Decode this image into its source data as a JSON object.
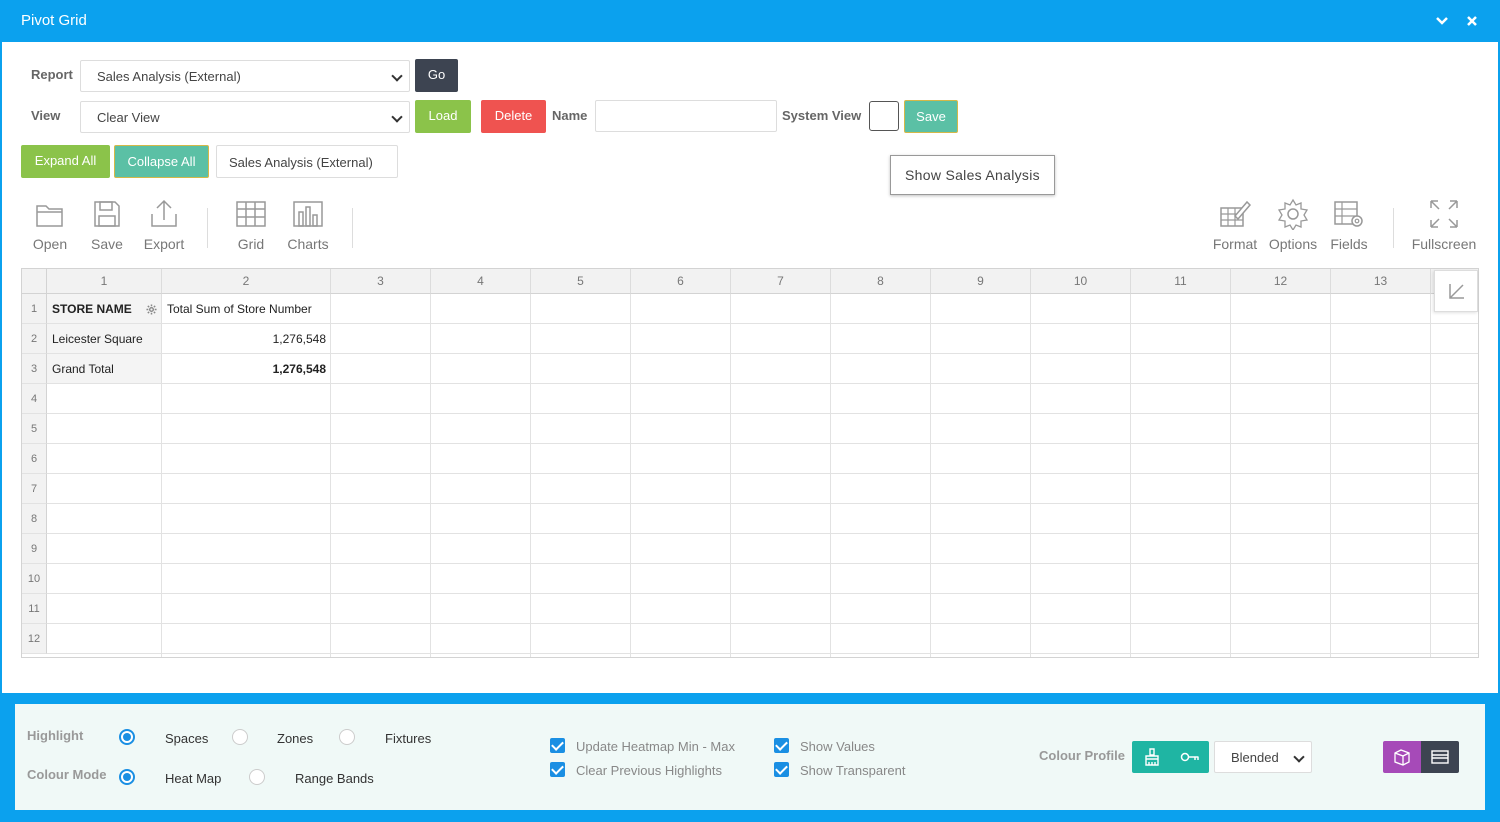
{
  "window": {
    "title": "Pivot Grid"
  },
  "controls": {
    "report_label": "Report",
    "report_value": "Sales Analysis (External)",
    "go_label": "Go",
    "view_label": "View",
    "view_value": "Clear View",
    "load_label": "Load",
    "delete_label": "Delete",
    "name_label": "Name",
    "name_value": "",
    "system_view_label": "System View",
    "save_label": "Save",
    "expand_all_label": "Expand All",
    "collapse_all_label": "Collapse All",
    "report_tag": "Sales Analysis (External)",
    "tooltip": "Show Sales Analysis"
  },
  "toolbar": {
    "open": "Open",
    "save": "Save",
    "export": "Export",
    "grid": "Grid",
    "charts": "Charts",
    "format": "Format",
    "options": "Options",
    "fields": "Fields",
    "fullscreen": "Fullscreen"
  },
  "grid": {
    "columns": [
      "1",
      "2",
      "3",
      "4",
      "5",
      "6",
      "7",
      "8",
      "9",
      "10",
      "11",
      "12",
      "13"
    ],
    "rows": [
      "1",
      "2",
      "3",
      "4",
      "5",
      "6",
      "7",
      "8",
      "9",
      "10",
      "11",
      "12"
    ],
    "header": {
      "store_name": "STORE NAME",
      "measure": "Total Sum of Store Number"
    },
    "data": [
      {
        "label": "Leicester Square",
        "value": "1,276,548"
      }
    ],
    "total": {
      "label": "Grand Total",
      "value": "1,276,548"
    }
  },
  "bottom": {
    "highlight_label": "Highlight",
    "highlight_options": [
      "Spaces",
      "Zones",
      "Fixtures"
    ],
    "colour_mode_label": "Colour Mode",
    "colour_mode_options": [
      "Heat Map",
      "Range Bands"
    ],
    "checks": [
      "Update Heatmap Min - Max",
      "Clear Previous Highlights",
      "Show Values",
      "Show Transparent"
    ],
    "colour_profile_label": "Colour Profile",
    "colour_profile_value": "Blended"
  },
  "colors": {
    "titlebar": "#0ba1ee",
    "go": "#3d4451",
    "load": "#8bc34a",
    "delete": "#ef5350",
    "save": "#5bc0a5",
    "expand": "#8bc34a",
    "collapse": "#5bc0a5",
    "purple": "#a64ab8",
    "dark": "#3d4451"
  }
}
